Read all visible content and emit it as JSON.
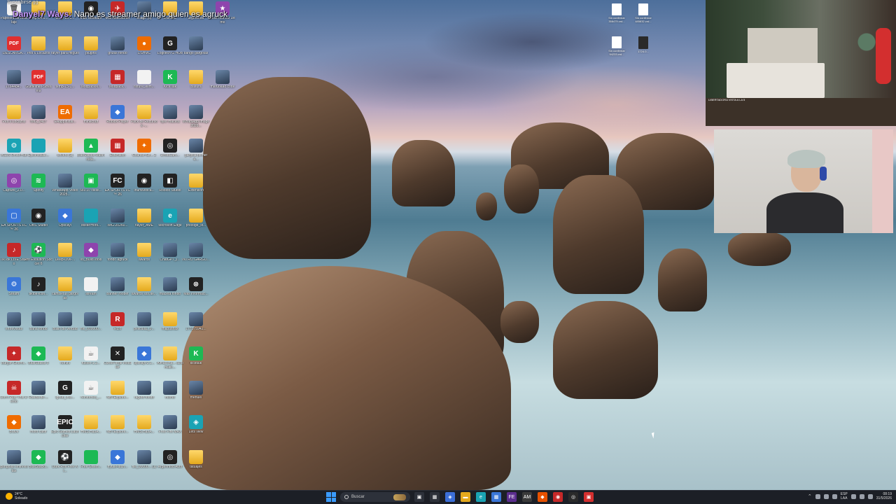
{
  "overlay": {
    "top_text": "Suscribirse.gg",
    "user": "Danyel7 Ways:",
    "message": " Nano es streamer amigo quien es agruck"
  },
  "desktop_icons": [
    {
      "label": "Papelera de reciclaje",
      "kind": "doc",
      "glyph": "🗑"
    },
    {
      "label": "temp-14-1...",
      "kind": "folder",
      "glyph": ""
    },
    {
      "label": "temp-18-1...",
      "kind": "folder",
      "glyph": ""
    },
    {
      "label": "Iriun Webcam",
      "kind": "dark",
      "glyph": "◉"
    },
    {
      "label": "MSI Afterburner",
      "kind": "red",
      "glyph": "✈"
    },
    {
      "label": "image (6)",
      "kind": "img",
      "glyph": ""
    },
    {
      "label": "DSHMC",
      "kind": "folder",
      "glyph": ""
    },
    {
      "label": "argenmod",
      "kind": "folder",
      "glyph": ""
    },
    {
      "label": "LockYourOD Demo",
      "kind": "purple",
      "glyph": "★"
    },
    {
      "label": "DESCARGA...",
      "kind": "pdf",
      "glyph": "PDF"
    },
    {
      "label": "Pes 6 Locazos",
      "kind": "folder",
      "glyph": ""
    },
    {
      "label": "falyer para miguel",
      "kind": "folder",
      "glyph": ""
    },
    {
      "label": "plugins",
      "kind": "folder",
      "glyph": ""
    },
    {
      "label": "grizas fondo",
      "kind": "img",
      "glyph": ""
    },
    {
      "label": "DSHMC",
      "kind": "orange",
      "glyph": "●"
    },
    {
      "label": "Logitech G HUB",
      "kind": "dark",
      "glyph": "G"
    },
    {
      "label": "bango gargolas",
      "kind": "img",
      "glyph": ""
    },
    {
      "label": "1764484...",
      "kind": "img",
      "glyph": ""
    },
    {
      "label": "Guidelines-Streams",
      "kind": "pdf",
      "glyph": "PDF"
    },
    {
      "label": "temp-15-1...",
      "kind": "folder",
      "glyph": ""
    },
    {
      "label": "ModpackM...",
      "kind": "folder",
      "glyph": ""
    },
    {
      "label": "Modpack...",
      "kind": "red",
      "glyph": "▦"
    },
    {
      "label": "fixture_elim...",
      "kind": "doc",
      "glyph": ""
    },
    {
      "label": "KickTalk",
      "kind": "green",
      "glyph": "K"
    },
    {
      "label": "basura",
      "kind": "folder",
      "glyph": ""
    },
    {
      "label": "maruoaad code",
      "kind": "img",
      "glyph": ""
    },
    {
      "label": "Pes 6 Locazos",
      "kind": "folder",
      "glyph": ""
    },
    {
      "label": "IMG_2417",
      "kind": "img",
      "glyph": ""
    },
    {
      "label": "EAappinstal...",
      "kind": "orange",
      "glyph": "EA"
    },
    {
      "label": "minecraft",
      "kind": "folder",
      "glyph": ""
    },
    {
      "label": "Roblox Player",
      "kind": "app",
      "glyph": "◆"
    },
    {
      "label": "Pack de Recursos -...",
      "kind": "folder",
      "glyph": ""
    },
    {
      "label": "flyer maceta",
      "kind": "img",
      "glyph": ""
    },
    {
      "label": "WhatsApp Image 2026...",
      "kind": "img",
      "glyph": ""
    },
    {
      "label": "ASUS DriverHub",
      "kind": "teal",
      "glyph": "⚙"
    },
    {
      "label": "EpicInstalle...",
      "kind": "teal",
      "glyph": ""
    },
    {
      "label": "drivers (1)",
      "kind": "folder",
      "glyph": ""
    },
    {
      "label": "BlueStacks Multi-Insta...",
      "kind": "green",
      "glyph": "▲"
    },
    {
      "label": "Extension",
      "kind": "red",
      "glyph": "▦"
    },
    {
      "label": "Counter-Str... 2",
      "kind": "orange",
      "glyph": "✦"
    },
    {
      "label": "DroidCam...",
      "kind": "dark",
      "glyph": "◎"
    },
    {
      "label": "gargola primer e...",
      "kind": "img",
      "glyph": ""
    },
    {
      "label": "Capture_2.0...",
      "kind": "purple",
      "glyph": "◎"
    },
    {
      "label": "Spotify",
      "kind": "green",
      "glyph": "≋"
    },
    {
      "label": "WhatsApp Video 2025...",
      "kind": "img",
      "glyph": ""
    },
    {
      "label": "580.97-desk...",
      "kind": "green",
      "glyph": "▣"
    },
    {
      "label": "EA SPORTS FC™ 26",
      "kind": "dark",
      "glyph": "FC"
    },
    {
      "label": "IriunWebca...",
      "kind": "dark",
      "glyph": "◉"
    },
    {
      "label": "Roblox Studio",
      "kind": "dark",
      "glyph": "◧"
    },
    {
      "label": "Extension",
      "kind": "folder",
      "glyph": ""
    },
    {
      "label": "EA SPORTS FC™ 26",
      "kind": "app",
      "glyph": "▢"
    },
    {
      "label": "OBS Studio",
      "kind": "dark",
      "glyph": "◉"
    },
    {
      "label": "Upscayl",
      "kind": "app",
      "glyph": "◆"
    },
    {
      "label": "MisterHors...",
      "kind": "teal",
      "glyph": ""
    },
    {
      "label": "IMG-20260...",
      "kind": "img",
      "glyph": ""
    },
    {
      "label": "flayer_AME",
      "kind": "folder",
      "glyph": ""
    },
    {
      "label": "Microsoft Edge",
      "kind": "teal",
      "glyph": "e"
    },
    {
      "label": "prestige_st...",
      "kind": "folder",
      "glyph": ""
    },
    {
      "label": "TikTok LIVE Studio",
      "kind": "red",
      "glyph": "♪"
    },
    {
      "label": "Pro Evolution Soccer 6",
      "kind": "green",
      "glyph": "⚽"
    },
    {
      "label": "Deep-Live-...",
      "kind": "folder",
      "glyph": ""
    },
    {
      "label": "vs_BuildTools",
      "kind": "purple",
      "glyph": "◆"
    },
    {
      "label": "fondo agruck",
      "kind": "img",
      "glyph": ""
    },
    {
      "label": "awards",
      "kind": "folder",
      "glyph": ""
    },
    {
      "label": "ChatGPT_I...",
      "kind": "img",
      "glyph": ""
    },
    {
      "label": "INTRO GARGO...",
      "kind": "img",
      "glyph": ""
    },
    {
      "label": "Steam",
      "kind": "app",
      "glyph": "⚙"
    },
    {
      "label": "tiktok-icon...",
      "kind": "dark",
      "glyph": "♪"
    },
    {
      "label": "camisetas gargolas",
      "kind": "folder",
      "glyph": ""
    },
    {
      "label": "stream",
      "kind": "doc",
      "glyph": ""
    },
    {
      "label": "banner roobet",
      "kind": "img",
      "glyph": ""
    },
    {
      "label": "awards sss.ae...",
      "kind": "folder",
      "glyph": ""
    },
    {
      "label": "maceta fondo",
      "kind": "img",
      "glyph": ""
    },
    {
      "label": "Más informaci...",
      "kind": "dark",
      "glyph": "⊗"
    },
    {
      "label": "entrevistas",
      "kind": "img",
      "glyph": ""
    },
    {
      "label": "baña fondo",
      "kind": "img",
      "glyph": ""
    },
    {
      "label": "ballin de verdad",
      "kind": "img",
      "glyph": ""
    },
    {
      "label": "file_000000...",
      "kind": "img",
      "glyph": ""
    },
    {
      "label": "Rust",
      "kind": "red",
      "glyph": "R"
    },
    {
      "label": "pelicula1_9...",
      "kind": "img",
      "glyph": ""
    },
    {
      "label": "mapashax",
      "kind": "folder",
      "glyph": ""
    },
    {
      "label": "176975942...",
      "kind": "img",
      "glyph": ""
    },
    {
      "label": "Burglin Gnomi...",
      "kind": "red",
      "glyph": "✦"
    },
    {
      "label": "BlueStacks 5",
      "kind": "green",
      "glyph": "◆"
    },
    {
      "label": "remini",
      "kind": "folder",
      "glyph": ""
    },
    {
      "label": "fusion-1.2...",
      "kind": "doc",
      "glyph": "☕"
    },
    {
      "label": "CurseForge Installer",
      "kind": "dark",
      "glyph": "✕"
    },
    {
      "label": "upscayl-2.1...",
      "kind": "app",
      "glyph": "◆"
    },
    {
      "label": "Almacena... automatic...",
      "kind": "folder",
      "glyph": ""
    },
    {
      "label": "kicktalk",
      "kind": "green",
      "glyph": "K"
    },
    {
      "label": "Don't Play This Demo",
      "kind": "red",
      "glyph": "☠"
    },
    {
      "label": "Rueda-de-...",
      "kind": "img",
      "glyph": ""
    },
    {
      "label": "lghub_inst...",
      "kind": "dark",
      "glyph": "G"
    },
    {
      "label": "reinforced_...",
      "kind": "doc",
      "glyph": "☕"
    },
    {
      "label": "NBTExplore...",
      "kind": "folder",
      "glyph": ""
    },
    {
      "label": "rageto fondo",
      "kind": "img",
      "glyph": ""
    },
    {
      "label": "momo",
      "kind": "img",
      "glyph": ""
    },
    {
      "label": "menuel",
      "kind": "img",
      "glyph": ""
    },
    {
      "label": "Brave",
      "kind": "orange",
      "glyph": "◆"
    },
    {
      "label": "mofo cattfr",
      "kind": "img",
      "glyph": ""
    },
    {
      "label": "Epic Games Launcher",
      "kind": "dark",
      "glyph": "EPIC"
    },
    {
      "label": "HMS.HasA...",
      "kind": "folder",
      "glyph": ""
    },
    {
      "label": "NBTExplore...",
      "kind": "folder",
      "glyph": ""
    },
    {
      "label": "HMS.HasA...",
      "kind": "folder",
      "glyph": ""
    },
    {
      "label": "Free Fire MAX",
      "kind": "img",
      "glyph": ""
    },
    {
      "label": "Lets view",
      "kind": "teal",
      "glyph": "◈"
    },
    {
      "label": "gartgolas entrevistas",
      "kind": "img",
      "glyph": ""
    },
    {
      "label": "BlueStackl...",
      "kind": "green",
      "glyph": "◆"
    },
    {
      "label": "Dark Roll Free Ki...",
      "kind": "dark",
      "glyph": "⚽"
    },
    {
      "label": "Free Green...",
      "kind": "green",
      "glyph": ""
    },
    {
      "label": "hytale-laun...",
      "kind": "app",
      "glyph": "◆"
    },
    {
      "label": "file_00000... (1)",
      "kind": "img",
      "glyph": ""
    },
    {
      "label": "Argenmod Auth",
      "kind": "dark",
      "glyph": "◎"
    },
    {
      "label": "tatuajes",
      "kind": "folder",
      "glyph": ""
    }
  ],
  "right_files": [
    {
      "label": "Sin confirmar 358479.crd...",
      "kind": "doc"
    },
    {
      "label": "Sin confirmar 485832.crd...",
      "kind": "doc"
    },
    {
      "label": "Sin confirmar 94233.crd...",
      "kind": "doc"
    },
    {
      "label": "1724.0...",
      "kind": "dark"
    }
  ],
  "camera": {
    "room_label": "LIBERTADORA VISTA A LA 5"
  },
  "taskbar": {
    "weather_temp": "24°C",
    "weather_desc": "Soleado",
    "search_placeholder": "Buscar",
    "lang_top": "ESP",
    "lang_bottom": "LAA",
    "time": "08:19",
    "date": "31/5/2026",
    "apps": [
      {
        "name": "task-view-icon",
        "glyph": "▣",
        "color": "#2d313a"
      },
      {
        "name": "file-explorer-icon",
        "glyph": "▦",
        "color": "#2d313a"
      },
      {
        "name": "copilot-icon",
        "glyph": "◈",
        "color": "#3b6fd8"
      },
      {
        "name": "explorer-folder-icon",
        "glyph": "▬",
        "color": "#e4a91d"
      },
      {
        "name": "edge-icon",
        "glyph": "e",
        "color": "#1aa3b4"
      },
      {
        "name": "store-icon",
        "glyph": "▦",
        "color": "#3a76d8"
      },
      {
        "name": "fe-icon",
        "glyph": "FE",
        "color": "#5b2d8e"
      },
      {
        "name": "ame-icon",
        "glyph": "AM",
        "color": "#3a3a3a"
      },
      {
        "name": "brave-icon",
        "glyph": "◆",
        "color": "#e65100"
      },
      {
        "name": "chrome-icon",
        "glyph": "◉",
        "color": "#c62828"
      },
      {
        "name": "obs-icon",
        "glyph": "◎",
        "color": "#2a2a2a"
      },
      {
        "name": "recorder-icon",
        "glyph": "▣",
        "color": "#d32f2f"
      }
    ]
  }
}
